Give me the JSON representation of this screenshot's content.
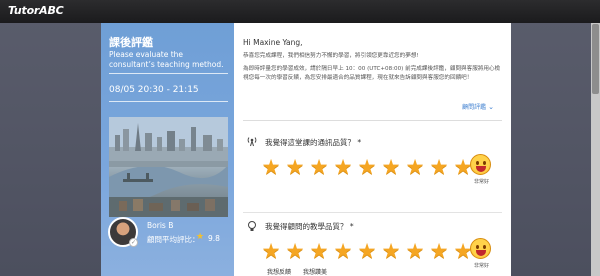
{
  "app": {
    "logo": "TutorABC"
  },
  "left": {
    "title": "課後評鑑",
    "subtitle": "Please evaluate the consultant’s teaching method.",
    "time": "08/05 20:30 - 21:15",
    "consultant": {
      "name": "Boris B",
      "rating_label": "顧問平均評比：",
      "rating_value": "9.8"
    }
  },
  "main": {
    "greeting": "Hi Maxine Yang,",
    "intro": [
      "恭喜您完成課程，我們相信努力不懈的學習，將引領您更靠近您的夢想!",
      "為即時評量您的學習成效，請於隔日早上 10：00 (UTC+08:00) 前完成課後評鑑，顧問與客服將用心檢視您每一次的學習反饋，為您安排最適合的品質課程，現在就來告訴顧問與客服您的回饋吧！"
    ],
    "details_link": "顧問評鑑",
    "questions": [
      {
        "icon": "broadcast-icon",
        "text": "我覺得這堂課的通訊品質？ *",
        "rating": 9,
        "max": 9,
        "emoji_label": "非常好"
      },
      {
        "icon": "lightbulb-icon",
        "text": "我覺得顧問的教學品質？ *",
        "rating": 9,
        "max": 9,
        "emoji_label": "非常好"
      }
    ],
    "tabs": [
      {
        "label": "我想反饋",
        "active": false
      },
      {
        "label": "我想讚美",
        "active": true
      }
    ]
  },
  "colors": {
    "accent": "#3d7fd0",
    "star": "#f5a623",
    "panel_blue": "#7aa6dc"
  }
}
